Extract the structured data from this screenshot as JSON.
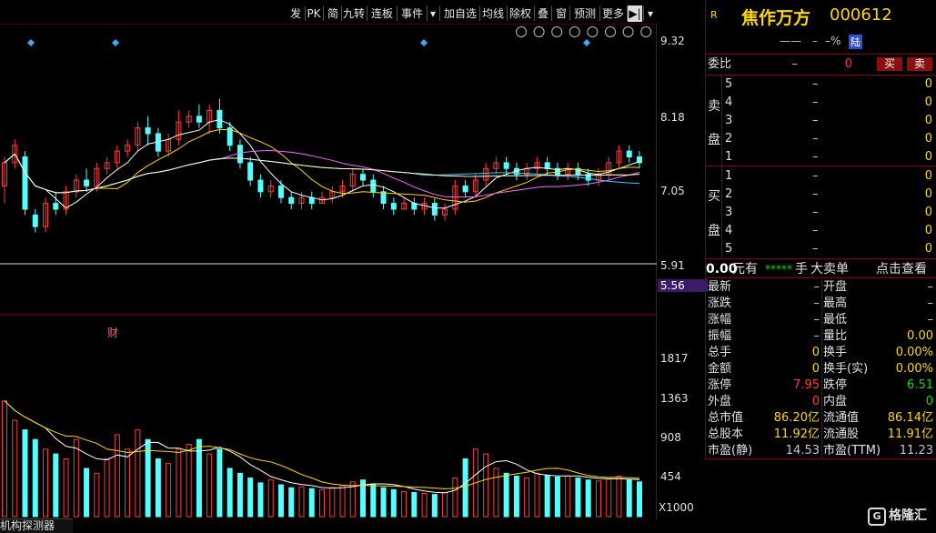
{
  "toolbar": {
    "buttons": [
      "发",
      "PK",
      "简",
      "九转",
      "连板",
      "事件",
      "▾",
      "加自选",
      "均线",
      "除权",
      "叠",
      "窗",
      "预测",
      "更多",
      "▶|",
      "▾"
    ]
  },
  "chart": {
    "price_ticks": [
      "9.32",
      "8.18",
      "7.05",
      "5.91"
    ],
    "highlight_price": "5.56",
    "vol_ticks": [
      "1817",
      "1363",
      "908",
      "454"
    ],
    "vol_unit": "X1000",
    "event_label": "财"
  },
  "chart_data": [
    {
      "type": "candlestick",
      "title": "",
      "ylim": [
        5.56,
        9.6
      ],
      "ticks": [
        9.32,
        8.18,
        7.05,
        5.91
      ],
      "candles": [
        [
          6.9,
          7.3,
          7.4,
          6.6
        ],
        [
          7.3,
          7.6,
          7.7,
          7.2
        ],
        [
          7.4,
          6.5,
          7.5,
          6.4
        ],
        [
          6.4,
          6.2,
          6.5,
          6.1
        ],
        [
          6.2,
          6.6,
          6.7,
          6.1
        ],
        [
          6.6,
          6.5,
          6.8,
          6.4
        ],
        [
          6.5,
          6.8,
          6.9,
          6.4
        ],
        [
          6.8,
          7.0,
          7.1,
          6.7
        ],
        [
          7.0,
          6.9,
          7.2,
          6.8
        ],
        [
          6.9,
          7.2,
          7.3,
          6.8
        ],
        [
          7.2,
          7.3,
          7.4,
          7.1
        ],
        [
          7.3,
          7.5,
          7.6,
          7.2
        ],
        [
          7.5,
          7.6,
          7.7,
          7.4
        ],
        [
          7.6,
          7.9,
          8.0,
          7.5
        ],
        [
          7.9,
          7.8,
          8.1,
          7.6
        ],
        [
          7.8,
          7.5,
          7.9,
          7.4
        ],
        [
          7.5,
          7.7,
          7.8,
          7.4
        ],
        [
          7.7,
          8.0,
          8.2,
          7.6
        ],
        [
          8.0,
          8.1,
          8.2,
          7.9
        ],
        [
          8.1,
          8.0,
          8.3,
          7.9
        ],
        [
          8.0,
          8.2,
          8.3,
          7.8
        ],
        [
          8.2,
          7.9,
          8.4,
          7.8
        ],
        [
          7.9,
          7.6,
          8.0,
          7.5
        ],
        [
          7.6,
          7.3,
          7.7,
          7.2
        ],
        [
          7.3,
          7.0,
          7.4,
          6.9
        ],
        [
          7.0,
          6.8,
          7.1,
          6.7
        ],
        [
          6.8,
          6.9,
          7.0,
          6.7
        ],
        [
          6.9,
          6.7,
          7.0,
          6.6
        ],
        [
          6.7,
          6.6,
          6.8,
          6.5
        ],
        [
          6.6,
          6.7,
          6.8,
          6.5
        ],
        [
          6.7,
          6.6,
          6.8,
          6.5
        ],
        [
          6.6,
          6.7,
          6.8,
          6.6
        ],
        [
          6.7,
          6.8,
          6.9,
          6.6
        ],
        [
          6.8,
          6.9,
          7.0,
          6.7
        ],
        [
          6.9,
          7.1,
          7.2,
          6.8
        ],
        [
          7.1,
          7.0,
          7.2,
          6.9
        ],
        [
          7.0,
          6.8,
          7.1,
          6.7
        ],
        [
          6.8,
          6.6,
          6.9,
          6.5
        ],
        [
          6.6,
          6.5,
          6.7,
          6.4
        ],
        [
          6.5,
          6.6,
          6.7,
          6.5
        ],
        [
          6.6,
          6.5,
          6.7,
          6.4
        ],
        [
          6.5,
          6.6,
          6.7,
          6.4
        ],
        [
          6.6,
          6.4,
          6.7,
          6.3
        ],
        [
          6.4,
          6.5,
          6.6,
          6.3
        ],
        [
          6.5,
          6.9,
          7.0,
          6.4
        ],
        [
          6.9,
          6.8,
          7.0,
          6.7
        ],
        [
          6.8,
          7.0,
          7.1,
          6.7
        ],
        [
          7.0,
          7.2,
          7.3,
          6.9
        ],
        [
          7.2,
          7.3,
          7.4,
          7.1
        ],
        [
          7.3,
          7.2,
          7.4,
          7.1
        ],
        [
          7.2,
          7.1,
          7.3,
          7.0
        ],
        [
          7.1,
          7.2,
          7.3,
          7.0
        ],
        [
          7.2,
          7.3,
          7.4,
          7.1
        ],
        [
          7.3,
          7.2,
          7.4,
          7.1
        ],
        [
          7.2,
          7.1,
          7.3,
          7.0
        ],
        [
          7.1,
          7.2,
          7.3,
          7.0
        ],
        [
          7.2,
          7.1,
          7.3,
          7.0
        ],
        [
          7.1,
          7.0,
          7.2,
          6.9
        ],
        [
          7.0,
          7.1,
          7.2,
          6.9
        ],
        [
          7.1,
          7.3,
          7.4,
          7.0
        ],
        [
          7.3,
          7.5,
          7.6,
          7.2
        ],
        [
          7.5,
          7.4,
          7.6,
          7.3
        ],
        [
          7.4,
          7.3,
          7.5,
          7.2
        ]
      ]
    },
    {
      "type": "bar",
      "title": "",
      "ylim": [
        0,
        2000
      ],
      "ticks": [
        1817,
        1363,
        908,
        454
      ],
      "unit": "X1000",
      "values": [
        1200,
        1000,
        900,
        800,
        700,
        650,
        600,
        800,
        500,
        450,
        600,
        850,
        700,
        900,
        800,
        600,
        550,
        700,
        750,
        800,
        650,
        700,
        500,
        450,
        400,
        350,
        380,
        330,
        300,
        310,
        290,
        280,
        300,
        320,
        360,
        380,
        340,
        300,
        280,
        260,
        250,
        240,
        230,
        250,
        400,
        600,
        700,
        650,
        500,
        450,
        420,
        400,
        450,
        430,
        410,
        420,
        400,
        380,
        370,
        390,
        420,
        380,
        360
      ],
      "up_color": "#ff3c3c",
      "down_color": "#54ffff"
    }
  ],
  "panel": {
    "market_tag": "R",
    "title": "焦作万方",
    "code": "000612",
    "sub_dash": "——",
    "sub_dash2": "–",
    "sub_pct": "–%",
    "lu_badge": "陆",
    "weibi": {
      "label": "委比",
      "val1": "–",
      "val2": "0",
      "buy_btn": "买",
      "sell_btn": "卖"
    },
    "sell_side": {
      "label1": "卖",
      "label2": "盘",
      "rows": [
        {
          "n": "5",
          "p": "–",
          "v": "0"
        },
        {
          "n": "4",
          "p": "–",
          "v": "0"
        },
        {
          "n": "3",
          "p": "–",
          "v": "0"
        },
        {
          "n": "2",
          "p": "–",
          "v": "0"
        },
        {
          "n": "1",
          "p": "–",
          "v": "0"
        }
      ]
    },
    "buy_side": {
      "label1": "买",
      "label2": "盘",
      "rows": [
        {
          "n": "1",
          "p": "–",
          "v": "0"
        },
        {
          "n": "2",
          "p": "–",
          "v": "0"
        },
        {
          "n": "3",
          "p": "–",
          "v": "0"
        },
        {
          "n": "4",
          "p": "–",
          "v": "0"
        },
        {
          "n": "5",
          "p": "–",
          "v": "0"
        }
      ]
    },
    "big_order": {
      "amount": "0.00",
      "unit": "元有",
      "stars": "*****",
      "hand": "手",
      "label": "大卖单",
      "link": "点击查看"
    },
    "stats": [
      {
        "l1": "最新",
        "v1": "–",
        "l2": "开盘",
        "v2": "–",
        "c1": "",
        "c2": ""
      },
      {
        "l1": "涨跌",
        "v1": "–",
        "l2": "最高",
        "v2": "–",
        "c1": "",
        "c2": ""
      },
      {
        "l1": "涨幅",
        "v1": "–",
        "l2": "最低",
        "v2": "–",
        "c1": "",
        "c2": ""
      },
      {
        "l1": "振幅",
        "v1": "–",
        "l2": "量比",
        "v2": "0.00",
        "c1": "",
        "c2": "yellow"
      },
      {
        "l1": "总手",
        "v1": "0",
        "l2": "换手",
        "v2": "0.00%",
        "c1": "yellow",
        "c2": "yellow"
      },
      {
        "l1": "金额",
        "v1": "0",
        "l2": "换手(实)",
        "v2": "0.00%",
        "c1": "yellow",
        "c2": "yellow"
      },
      {
        "l1": "涨停",
        "v1": "7.95",
        "l2": "跌停",
        "v2": "6.51",
        "c1": "red",
        "c2": "green"
      },
      {
        "l1": "外盘",
        "v1": "0",
        "l2": "内盘",
        "v2": "0",
        "c1": "red",
        "c2": "green"
      },
      {
        "l1": "总市值",
        "v1": "86.20亿",
        "l2": "流通值",
        "v2": "86.14亿",
        "c1": "yellow",
        "c2": "yellow"
      },
      {
        "l1": "总股本",
        "v1": "11.92亿",
        "l2": "流通股",
        "v2": "11.91亿",
        "c1": "yellow",
        "c2": "yellow"
      },
      {
        "l1": "市盈(静)",
        "v1": "14.53",
        "l2": "市盈(TTM)",
        "v2": "11.23",
        "c1": "",
        "c2": ""
      }
    ]
  },
  "bottom_tab": "机构探测器",
  "logo": "格隆汇",
  "colors": {
    "up": "#ff3c3c",
    "down": "#54ffff",
    "grid": "#8a0000",
    "ma5": "#ffffff",
    "ma10": "#ffd800",
    "ma20": "#ff66ff",
    "ma60": "#33ccff",
    "ma120": "#ffffcc"
  }
}
